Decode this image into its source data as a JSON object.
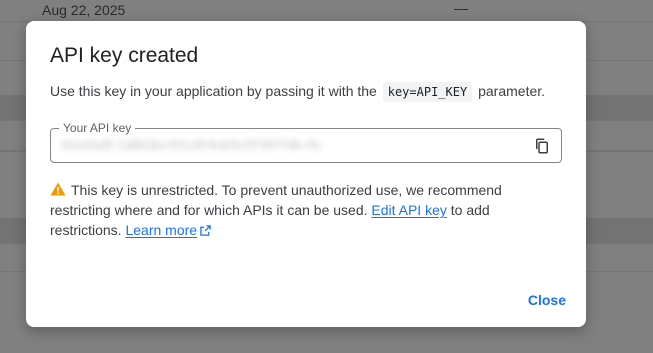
{
  "background": {
    "row_date": "Aug 22, 2025",
    "row_dash": "—"
  },
  "dialog": {
    "title": "API key created",
    "intro_before": "Use this key in your application by passing it with the",
    "intro_code": "key=API_KEY",
    "intro_after": "parameter.",
    "field_label": "Your API key",
    "field_value": "AIzaSyB-1aBtQkcXhLdIr4uk5nXFdHTdb-rfx",
    "copy_icon": "copy-icon",
    "warning_icon": "warning-icon",
    "warning_text": "This key is unrestricted. To prevent unauthorized use, we recommend restricting where and for which APIs it can be used.",
    "edit_link": "Edit API key",
    "warning_tail": "to add restrictions.",
    "learn_more": "Learn more",
    "close_label": "Close"
  },
  "colors": {
    "link": "#1a73e8",
    "warning": "#f29900",
    "scrim": "#808080"
  }
}
